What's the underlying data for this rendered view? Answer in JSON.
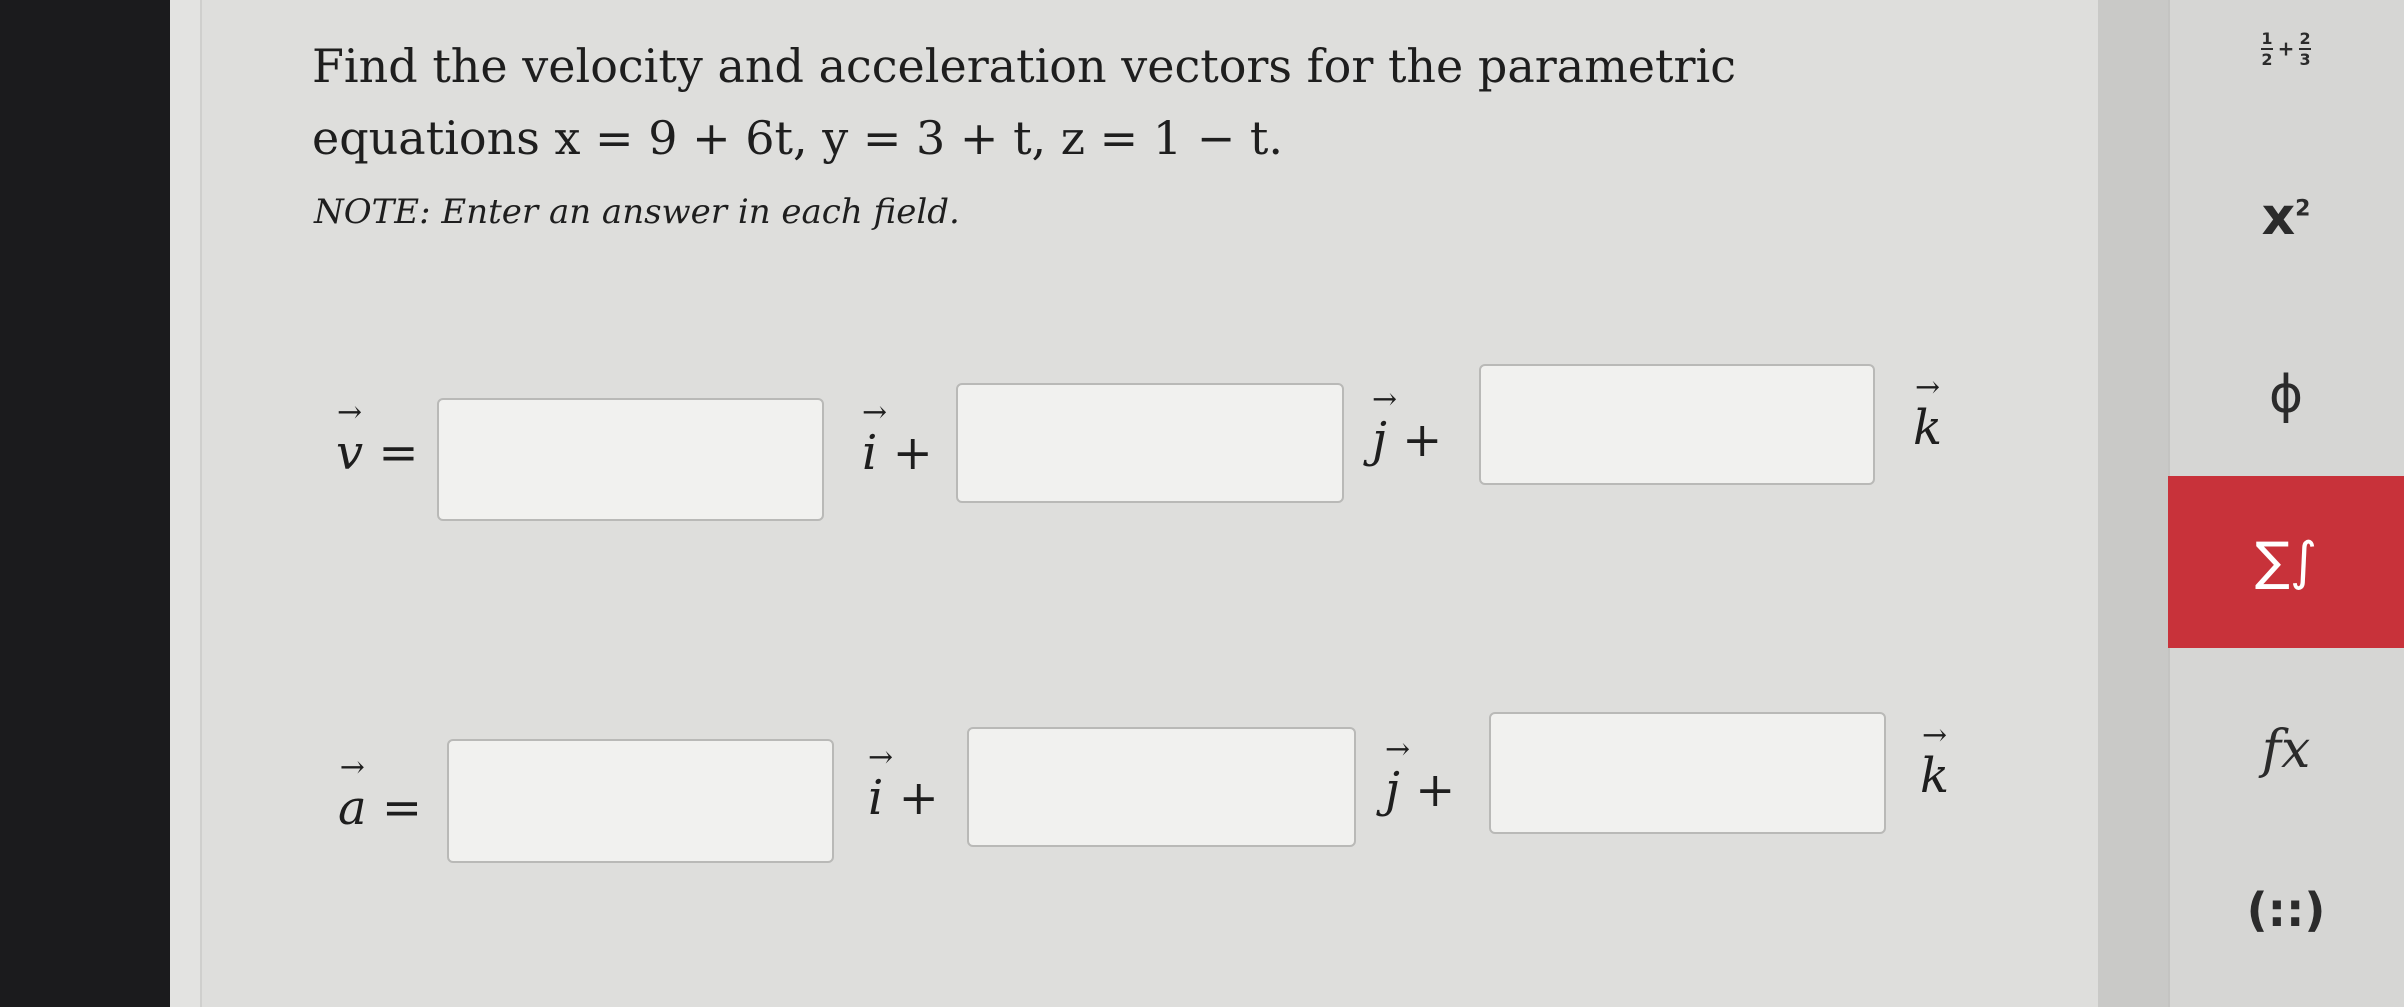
{
  "question": {
    "line1": "Find the velocity and acceleration vectors for the parametric",
    "line2": "equations x = 9 + 6t,  y = 3 + t,  z = 1 − t.",
    "note": "NOTE: Enter an answer in each field."
  },
  "velocity": {
    "lhs": "v",
    "eq": " =",
    "i": "i",
    "j": "j",
    "k": "k",
    "plus": " +",
    "fields": [
      "",
      "",
      ""
    ]
  },
  "acceleration": {
    "lhs": "a",
    "eq": " =",
    "i": "i",
    "j": "j",
    "k": "k",
    "plus": " +",
    "fields": [
      "",
      "",
      ""
    ]
  },
  "toolbar": {
    "fraction": {
      "num1": "1",
      "den1": "2",
      "op": "+",
      "num2": "2",
      "den2": "3"
    },
    "exponent": {
      "base": "x",
      "power": "2"
    },
    "special": "ϕ",
    "calculus": "∑∫",
    "functions": "fx",
    "matrix": "(::)",
    "active_color": "#c8323a"
  }
}
